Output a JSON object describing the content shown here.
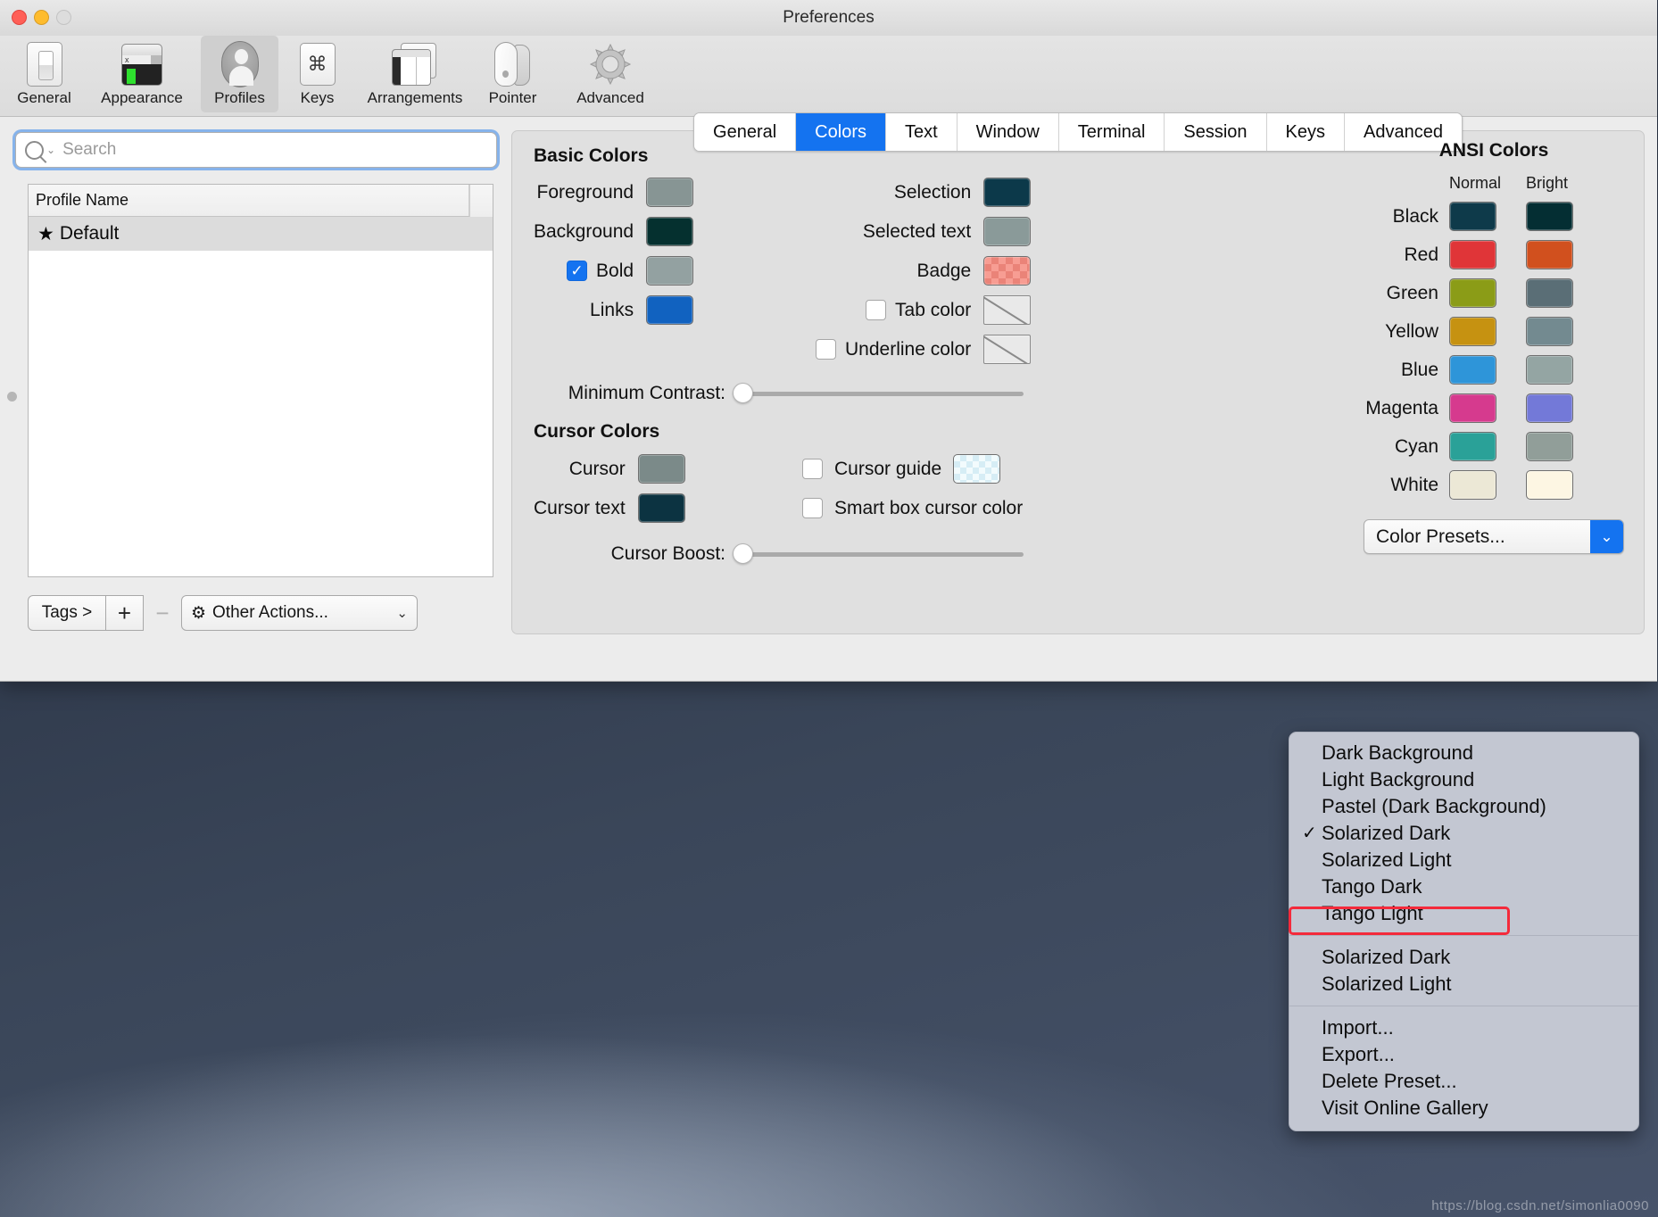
{
  "window": {
    "title": "Preferences",
    "traffic_lights": [
      "close-red",
      "minimize-yellow",
      "zoom-gray"
    ]
  },
  "toolbar": {
    "items": [
      {
        "label": "General",
        "icon": "general-switch-icon"
      },
      {
        "label": "Appearance",
        "icon": "appearance-terminal-icon"
      },
      {
        "label": "Profiles",
        "icon": "profiles-person-icon",
        "selected": true
      },
      {
        "label": "Keys",
        "icon": "keys-command-icon"
      },
      {
        "label": "Arrangements",
        "icon": "arrangements-windows-icon"
      },
      {
        "label": "Pointer",
        "icon": "pointer-mouse-icon"
      },
      {
        "label": "Advanced",
        "icon": "advanced-gear-icon"
      }
    ]
  },
  "sidebar": {
    "search": {
      "placeholder": "Search",
      "value": "",
      "icon": "search-icon"
    },
    "table": {
      "column_header": "Profile Name",
      "rows": [
        {
          "star": "★",
          "name": "Default",
          "selected": true
        }
      ]
    },
    "bottom_toolbar": {
      "tags_label": "Tags >",
      "add_label": "+",
      "remove_label": "−",
      "actions_label": "Other Actions...",
      "actions_icon": "gear-icon",
      "actions_chevron": "⌄"
    }
  },
  "tabs": [
    {
      "label": "General",
      "active": false
    },
    {
      "label": "Colors",
      "active": true
    },
    {
      "label": "Text",
      "active": false
    },
    {
      "label": "Window",
      "active": false
    },
    {
      "label": "Terminal",
      "active": false
    },
    {
      "label": "Session",
      "active": false
    },
    {
      "label": "Keys",
      "active": false
    },
    {
      "label": "Advanced",
      "active": false
    }
  ],
  "basic_colors": {
    "title": "Basic Colors",
    "left": [
      {
        "label": "Foreground",
        "color": "#879594",
        "checkbox": null
      },
      {
        "label": "Background",
        "color": "#05302f",
        "checkbox": null
      },
      {
        "label": "Bold",
        "color": "#93a1a1",
        "checkbox": true
      },
      {
        "label": "Links",
        "color": "#1162c0",
        "checkbox": null
      }
    ],
    "right": [
      {
        "label": "Selection",
        "color": "#0c394a",
        "checkbox": null,
        "style": "solid"
      },
      {
        "label": "Selected text",
        "color": "#8a9a99",
        "checkbox": null,
        "style": "solid"
      },
      {
        "label": "Badge",
        "color": "#f49a90",
        "checkbox": null,
        "style": "checker-red"
      },
      {
        "label": "Tab color",
        "color": "",
        "checkbox": false,
        "style": "empty"
      },
      {
        "label": "Underline color",
        "color": "",
        "checkbox": false,
        "style": "empty"
      }
    ],
    "minimum_contrast": {
      "label": "Minimum Contrast:",
      "value": 0
    }
  },
  "cursor_colors": {
    "title": "Cursor Colors",
    "left": [
      {
        "label": "Cursor",
        "color": "#7b8a89",
        "style": "solid"
      },
      {
        "label": "Cursor text",
        "color": "#0c3341",
        "style": "solid"
      }
    ],
    "right": [
      {
        "label": "Cursor guide",
        "checkbox": false,
        "color": "#e8f6fa",
        "style": "checker-cyan",
        "has_swatch": true
      },
      {
        "label": "Smart box cursor color",
        "checkbox": false,
        "color": "",
        "style": "none",
        "has_swatch": false
      }
    ],
    "cursor_boost": {
      "label": "Cursor Boost:",
      "value": 0
    }
  },
  "ansi_colors": {
    "title": "ANSI Colors",
    "header_normal": "Normal",
    "header_bright": "Bright",
    "rows": [
      {
        "name": "Black",
        "normal": "#0e3a4a",
        "bright": "#042e33"
      },
      {
        "name": "Red",
        "normal": "#e03538",
        "bright": "#d1501e"
      },
      {
        "name": "Green",
        "normal": "#8b9c17",
        "bright": "#5a6e76"
      },
      {
        "name": "Yellow",
        "normal": "#c69211",
        "bright": "#738a90"
      },
      {
        "name": "Blue",
        "normal": "#2e95d9",
        "bright": "#94a5a3"
      },
      {
        "name": "Magenta",
        "normal": "#d63a8e",
        "bright": "#7379d8"
      },
      {
        "name": "Cyan",
        "normal": "#2aa198",
        "bright": "#919e99"
      },
      {
        "name": "White",
        "normal": "#ece8d6",
        "bright": "#fdf6e3"
      }
    ]
  },
  "color_presets": {
    "button_label": "Color Presets...",
    "button_arrow": "⌄",
    "menu": {
      "group_builtin": [
        {
          "label": "Dark Background",
          "checked": false
        },
        {
          "label": "Light Background",
          "checked": false
        },
        {
          "label": "Pastel (Dark Background)",
          "checked": false
        },
        {
          "label": "Solarized Dark",
          "checked": true
        },
        {
          "label": "Solarized Light",
          "checked": false
        },
        {
          "label": "Tango Dark",
          "checked": false
        },
        {
          "label": "Tango Light",
          "checked": false
        }
      ],
      "group_custom": [
        {
          "label": "Solarized Dark",
          "checked": false
        },
        {
          "label": "Solarized Light",
          "checked": false
        }
      ],
      "group_actions": [
        {
          "label": "Import...",
          "checked": false
        },
        {
          "label": "Export...",
          "checked": false
        },
        {
          "label": "Delete Preset...",
          "checked": false
        },
        {
          "label": "Visit Online Gallery",
          "checked": false
        }
      ],
      "checkmark": "✓",
      "highlight_color": "#f42a3b"
    }
  },
  "watermark": "https://blog.csdn.net/simonlia0090"
}
